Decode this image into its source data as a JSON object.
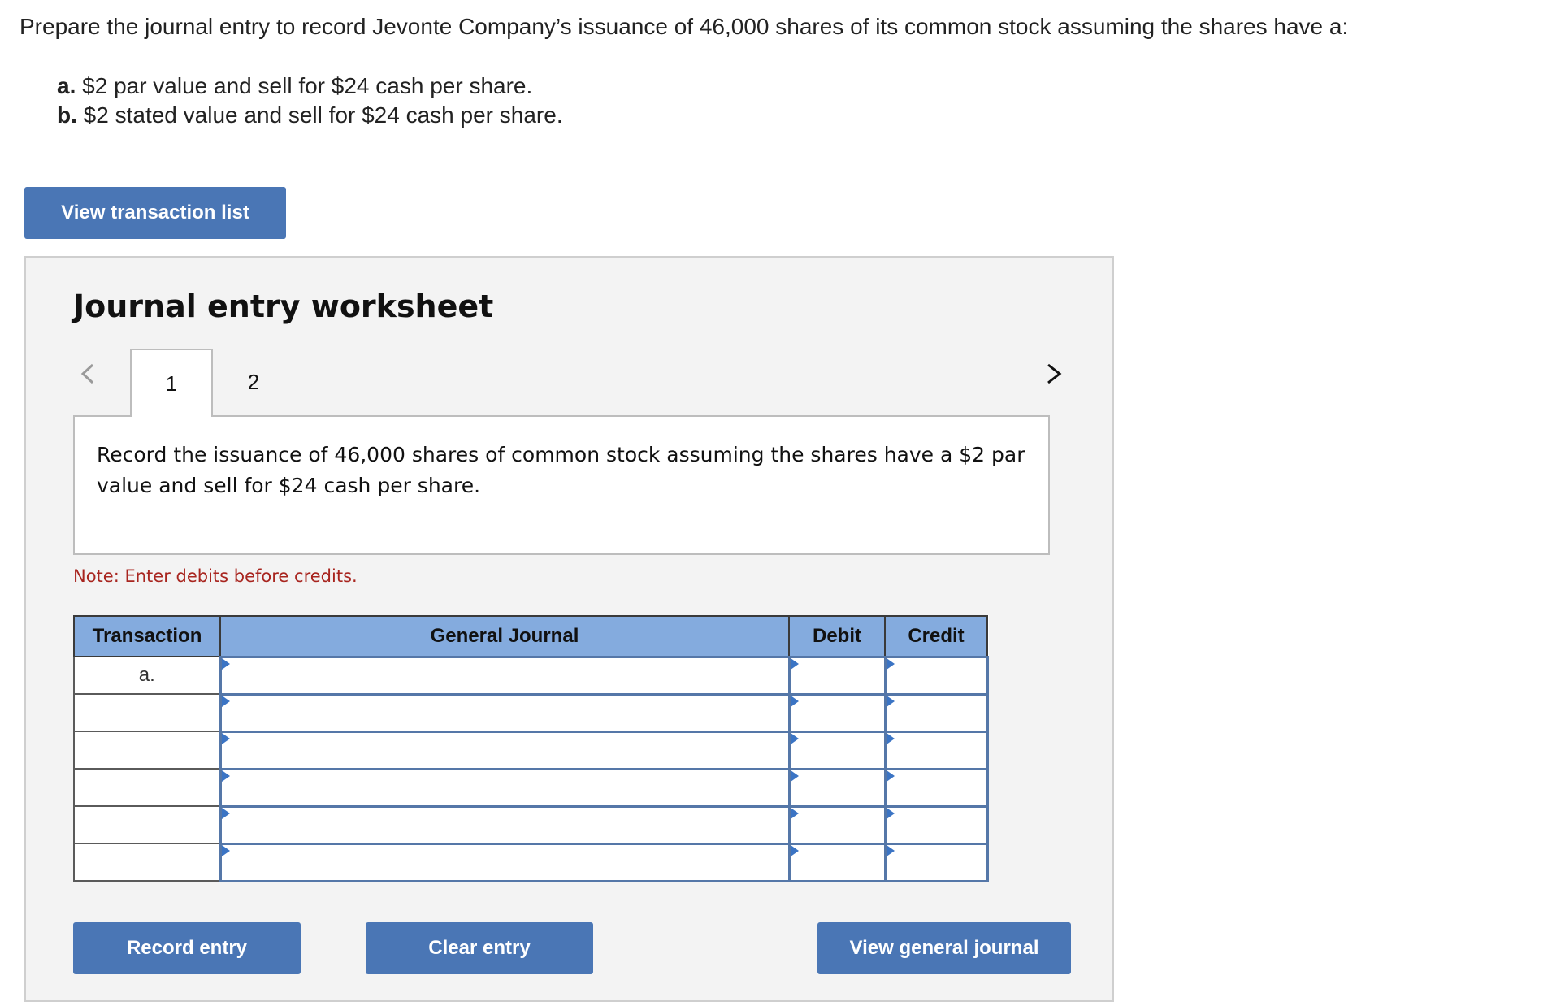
{
  "question": {
    "text": "Prepare the journal entry to record Jevonte Company’s issuance of 46,000 shares of its common stock assuming the shares have a:",
    "parts": [
      {
        "label": "a.",
        "text": " $2 par value and sell for $24 cash per share."
      },
      {
        "label": "b.",
        "text": " $2 stated value and sell for $24 cash per share."
      }
    ]
  },
  "view_transaction_list_label": "View transaction list",
  "worksheet": {
    "title": "Journal entry worksheet",
    "tabs": [
      "1",
      "2"
    ],
    "active_tab": "1",
    "prompt": "Record the issuance of 46,000 shares of common stock assuming the shares have a $2 par value and sell for $24 cash per share.",
    "note": "Note: Enter debits before credits.",
    "table": {
      "headers": {
        "transaction": "Transaction",
        "general_journal": "General Journal",
        "debit": "Debit",
        "credit": "Credit"
      },
      "rows": [
        {
          "transaction": "a.",
          "account": "",
          "debit": "",
          "credit": ""
        },
        {
          "transaction": "",
          "account": "",
          "debit": "",
          "credit": ""
        },
        {
          "transaction": "",
          "account": "",
          "debit": "",
          "credit": ""
        },
        {
          "transaction": "",
          "account": "",
          "debit": "",
          "credit": ""
        },
        {
          "transaction": "",
          "account": "",
          "debit": "",
          "credit": ""
        },
        {
          "transaction": "",
          "account": "",
          "debit": "",
          "credit": ""
        }
      ]
    },
    "buttons": {
      "record": "Record entry",
      "clear": "Clear entry",
      "view_general_journal": "View general journal"
    }
  },
  "colors": {
    "button_bg": "#4a76b5",
    "header_bg": "#84abde",
    "note_red": "#a8251f",
    "input_border": "#5577a8"
  },
  "icons": {
    "prev": "chevron-left-icon",
    "next": "chevron-right-icon",
    "dropdown": "dropdown-triangle-icon"
  }
}
